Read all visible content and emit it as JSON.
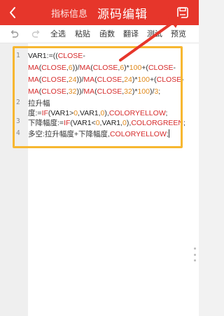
{
  "header": {
    "back_icon": "chevron-left-icon",
    "tab_info": "指标信息",
    "tab_source": "源码编辑",
    "save_icon": "save-icon",
    "bg_color": "#e6362b"
  },
  "toolbar": {
    "undo_icon": "undo-icon",
    "redo_icon": "redo-icon",
    "select_all": "全选",
    "paste": "粘贴",
    "function": "函数",
    "translate": "翻译",
    "test": "测试",
    "preview": "预览"
  },
  "editor": {
    "line_numbers": [
      "1",
      "2",
      "3",
      "4"
    ],
    "highlight_color": "#f7b731",
    "lines": [
      "VAR1:=((CLOSE-",
      "MA(CLOSE,6))/MA(CLOSE,6)*100+(CLOSE-",
      "MA(CLOSE,24))/MA(CLOSE,24)*100+(CLOSE-",
      "MA(CLOSE,32))/MA(CLOSE,32)*100)/3;",
      "拉升幅",
      "度:=IF(VAR1>0,VAR1,0),COLORYELLOW;",
      "下降幅度:=IF(VAR1<0,VAR1,0),COLORGREEN;",
      "多空:拉升幅度+下降幅度,COLORYELLOW;"
    ]
  }
}
